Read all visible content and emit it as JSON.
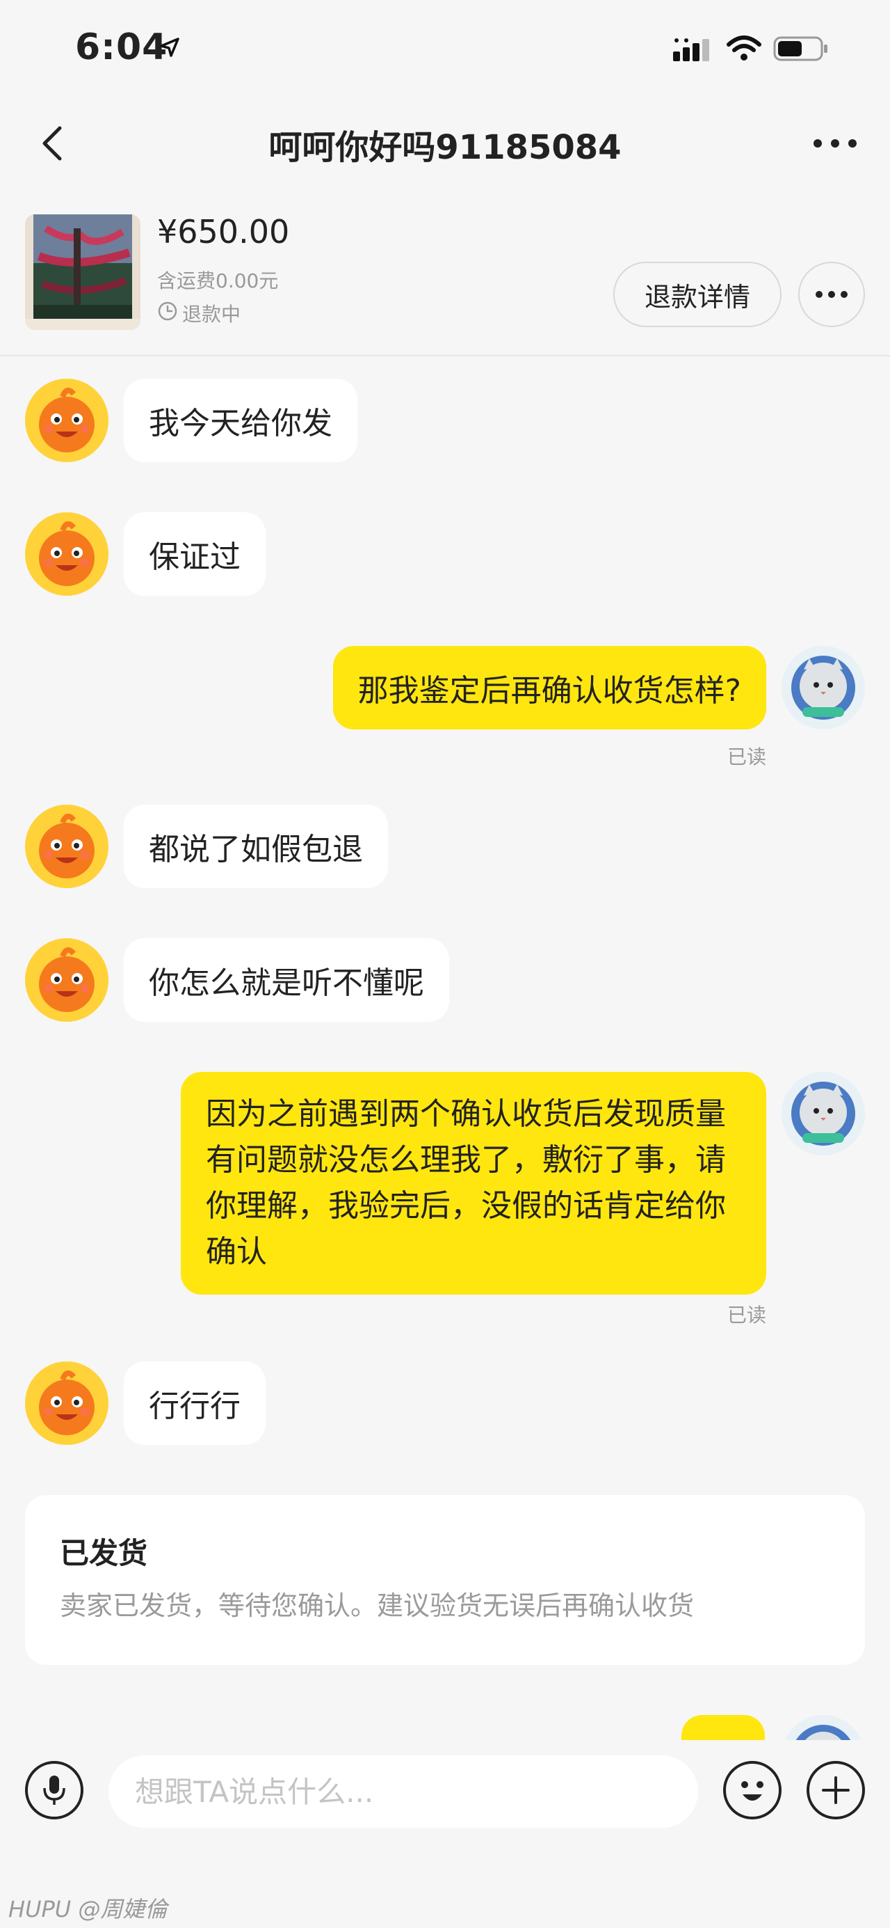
{
  "status_bar": {
    "time": "6:04"
  },
  "nav": {
    "title": "呵呵你好吗91185084"
  },
  "product": {
    "price": "¥650.00",
    "shipping": "含运费0.00元",
    "status": "退款中",
    "refund_button": "退款详情"
  },
  "messages": [
    {
      "side": "in",
      "text": "我今天给你发"
    },
    {
      "side": "in",
      "text": "保证过"
    },
    {
      "side": "out",
      "text": "那我鉴定后再确认收货怎样?",
      "read": "已读"
    },
    {
      "side": "in",
      "text": "都说了如假包退"
    },
    {
      "side": "in",
      "text": "你怎么就是听不懂呢"
    },
    {
      "side": "out",
      "lines": [
        "因为之前遇到两个确认收货后发现质量",
        "有问题就没怎么理我了，敷衍了事，请",
        "你理解，我验完后，没假的话肯定给你",
        "确认"
      ],
      "read": "已读"
    },
    {
      "side": "in",
      "text": "行行行"
    }
  ],
  "system_card": {
    "title": "已发货",
    "text": "卖家已发货，等待您确认。建议验货无误后再确认收货"
  },
  "input": {
    "placeholder": "想跟TA说点什么..."
  },
  "watermark": "HUPU @周婕倫"
}
